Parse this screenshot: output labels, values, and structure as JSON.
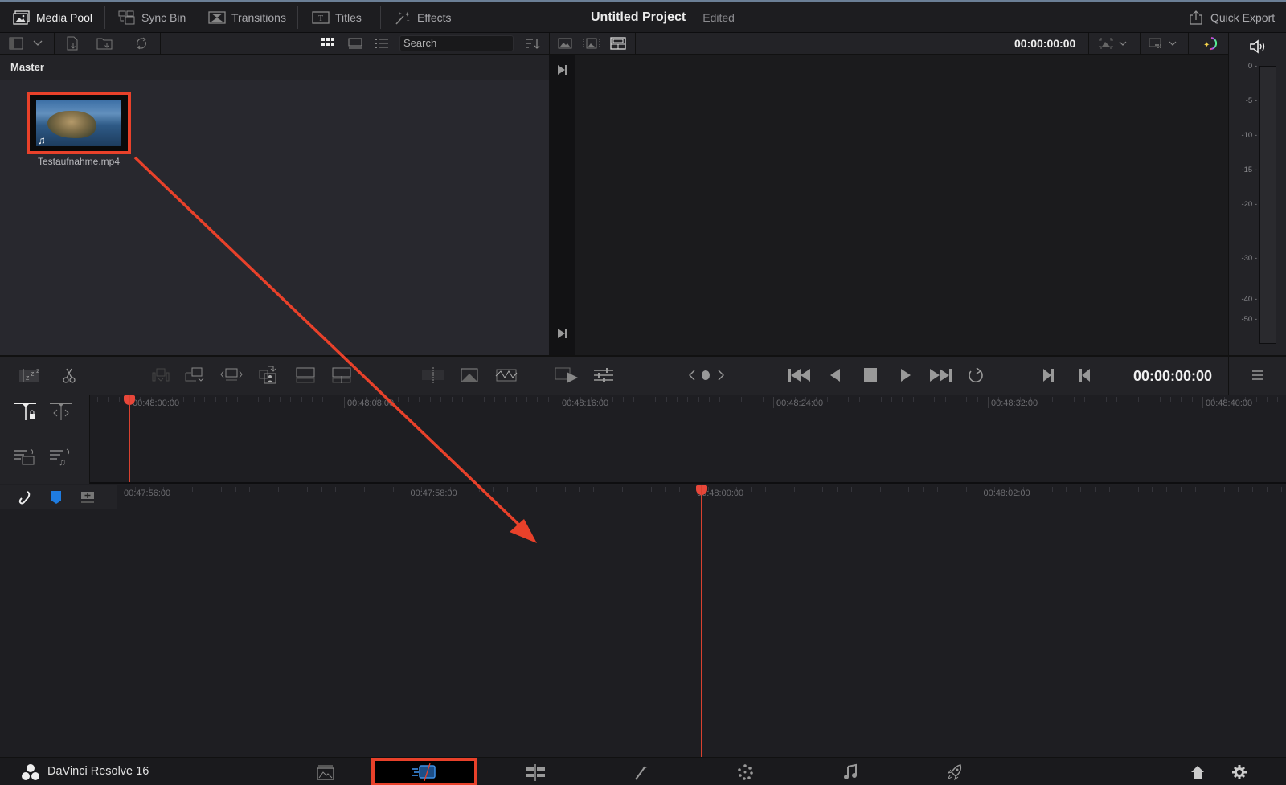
{
  "topbar": {
    "tabs": [
      {
        "label": "Media Pool",
        "icon": "media-pool-icon",
        "active": true
      },
      {
        "label": "Sync Bin",
        "icon": "sync-bin-icon",
        "active": false
      },
      {
        "label": "Transitions",
        "icon": "transitions-icon",
        "active": false
      },
      {
        "label": "Titles",
        "icon": "titles-icon",
        "active": false
      },
      {
        "label": "Effects",
        "icon": "effects-icon",
        "active": false
      }
    ],
    "project_name": "Untitled Project",
    "project_status": "Edited",
    "quick_export": "Quick Export"
  },
  "toolbar": {
    "search_placeholder": "Search",
    "viewer_timecode": "00:00:00:00"
  },
  "media_pool": {
    "bin": "Master",
    "clips": [
      {
        "name": "Testaufnahme.mp4",
        "has_audio": true,
        "highlighted": true
      }
    ]
  },
  "audio_meter": {
    "ticks": [
      "0",
      "-5",
      "-10",
      "-15",
      "-20",
      "-30",
      "-40",
      "-50"
    ]
  },
  "transport": {
    "timecode": "00:00:00:00"
  },
  "upper_timeline": {
    "ruler_labels": [
      "00:48:00:00",
      "00:48:08:00",
      "00:48:16:00",
      "00:48:24:00",
      "00:48:32:00",
      "00:48:40:00"
    ],
    "playhead": "00:48:00:00"
  },
  "lower_timeline": {
    "ruler_labels": [
      "00:47:56:00",
      "00:47:58:00",
      "00:48:00:00",
      "00:48:02:00"
    ],
    "playhead": "00:48:00:00"
  },
  "bottombar": {
    "app_name": "DaVinci Resolve 16",
    "pages": [
      "media",
      "cut",
      "edit",
      "fusion",
      "color",
      "fairlight",
      "deliver"
    ],
    "active_page": "cut"
  },
  "colors": {
    "accent_red": "#e8412a",
    "playhead": "#e8473a",
    "flag_blue": "#1f7ce0"
  }
}
